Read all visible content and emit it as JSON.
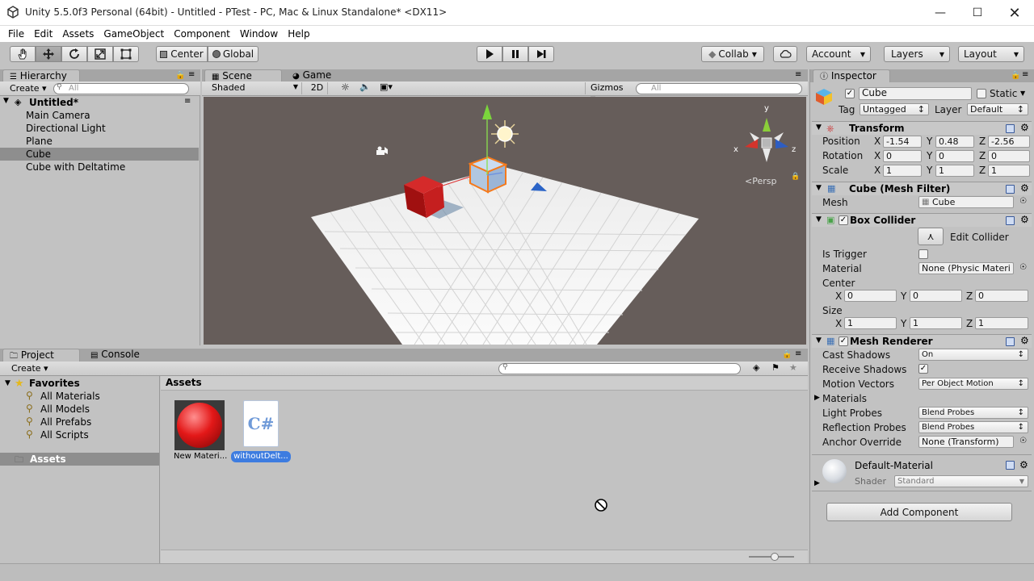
{
  "window": {
    "title": "Unity 5.5.0f3 Personal (64bit) - Untitled - PTest - PC, Mac & Linux Standalone* <DX11>"
  },
  "menu": [
    "File",
    "Edit",
    "Assets",
    "GameObject",
    "Component",
    "Window",
    "Help"
  ],
  "toolbar": {
    "pivot": "Center",
    "space": "Global",
    "collab": "Collab",
    "account": "Account",
    "layers": "Layers",
    "layout": "Layout"
  },
  "hierarchy": {
    "tab": "Hierarchy",
    "create": "Create",
    "search_placeholder": "All",
    "scene": "Untitled*",
    "items": [
      "Main Camera",
      "Directional Light",
      "Plane",
      "Cube",
      "Cube with Deltatime"
    ],
    "selected": "Cube"
  },
  "scene": {
    "tab_scene": "Scene",
    "tab_game": "Game",
    "shading": "Shaded",
    "mode2d": "2D",
    "gizmos": "Gizmos",
    "search_placeholder": "All",
    "persp": "Persp",
    "axis_x": "x",
    "axis_y": "y",
    "axis_z": "z"
  },
  "project": {
    "tab_project": "Project",
    "tab_console": "Console",
    "create": "Create",
    "favorites_label": "Favorites",
    "favorites": [
      "All Materials",
      "All Models",
      "All Prefabs",
      "All Scripts"
    ],
    "assets_root": "Assets",
    "breadcrumb": "Assets",
    "assets": [
      {
        "name": "New Materi...",
        "kind": "material"
      },
      {
        "name": "withoutDelt...",
        "kind": "script",
        "glyph": "C#"
      }
    ]
  },
  "inspector": {
    "tab": "Inspector",
    "object_name": "Cube",
    "static_label": "Static",
    "tag_label": "Tag",
    "tag": "Untagged",
    "layer_label": "Layer",
    "layer": "Default",
    "transform": {
      "title": "Transform",
      "rows": [
        {
          "label": "Position",
          "x": "-1.54",
          "y": "0.48",
          "z": "-2.56"
        },
        {
          "label": "Rotation",
          "x": "0",
          "y": "0",
          "z": "0"
        },
        {
          "label": "Scale",
          "x": "1",
          "y": "1",
          "z": "1"
        }
      ]
    },
    "mesh_filter": {
      "title": "Cube (Mesh Filter)",
      "mesh_label": "Mesh",
      "mesh": "Cube"
    },
    "box_collider": {
      "title": "Box Collider",
      "edit_collider": "Edit Collider",
      "is_trigger": "Is Trigger",
      "material_label": "Material",
      "material": "None (Physic Materi",
      "center_label": "Center",
      "center": {
        "x": "0",
        "y": "0",
        "z": "0"
      },
      "size_label": "Size",
      "size": {
        "x": "1",
        "y": "1",
        "z": "1"
      }
    },
    "mesh_renderer": {
      "title": "Mesh Renderer",
      "rows": [
        {
          "label": "Cast Shadows",
          "value": "On",
          "type": "select"
        },
        {
          "label": "Receive Shadows",
          "value": "",
          "type": "check"
        },
        {
          "label": "Motion Vectors",
          "value": "Per Object Motion",
          "type": "select"
        },
        {
          "label": "Materials",
          "value": "",
          "type": "fold"
        },
        {
          "label": "Light Probes",
          "value": "Blend Probes",
          "type": "select"
        },
        {
          "label": "Reflection Probes",
          "value": "Blend Probes",
          "type": "select"
        },
        {
          "label": "Anchor Override",
          "value": "None (Transform)",
          "type": "object"
        }
      ]
    },
    "material": {
      "name": "Default-Material",
      "shader_label": "Shader",
      "shader": "Standard"
    },
    "add_component": "Add Component"
  }
}
